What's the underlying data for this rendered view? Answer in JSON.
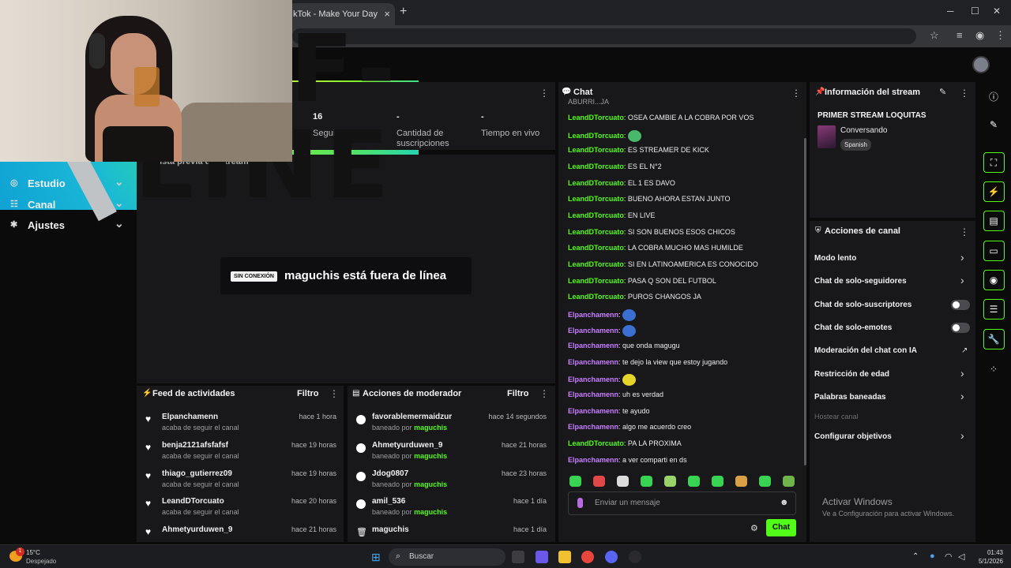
{
  "browser": {
    "tab_title": "kTok - Make Your Day",
    "tab_close": "×",
    "new_tab": "+",
    "win_min": "─",
    "win_max": "☐",
    "win_close": "✕"
  },
  "sidebar": {
    "items": [
      {
        "label": "Estudio",
        "icon": "camera-icon"
      },
      {
        "label": "Canal",
        "icon": "users-icon"
      },
      {
        "label": "Ajustes",
        "icon": "gear-icon"
      }
    ]
  },
  "stats": [
    {
      "value": "16",
      "label": "Seguidores"
    },
    {
      "value": "-",
      "label": "Cantidad de suscripciones"
    },
    {
      "value": "-",
      "label": "Tiempo en vivo"
    }
  ],
  "preview": {
    "title": "Vista previa del stream",
    "badge": "SIN CONEXIÓN",
    "message": "maguchis está fuera de línea",
    "art_line1": "OFF-",
    "art_line2": "LINE"
  },
  "activity_feed": {
    "title": "Feed de actividades",
    "filter": "Filtro",
    "items": [
      {
        "name": "Elpanchamenn",
        "sub": "acaba de seguir el canal",
        "time": "hace 1 hora"
      },
      {
        "name": "benja2121afsfafsf",
        "sub": "acaba de seguir el canal",
        "time": "hace 19 horas"
      },
      {
        "name": "thiago_gutierrez09",
        "sub": "acaba de seguir el canal",
        "time": "hace 19 horas"
      },
      {
        "name": "LeandDTorcuato",
        "sub": "acaba de seguir el canal",
        "time": "hace 20 horas"
      },
      {
        "name": "Ahmetyurduwen_9",
        "sub": "",
        "time": "hace 21 horas"
      }
    ]
  },
  "mod_actions": {
    "title": "Acciones de moderador",
    "filter": "Filtro",
    "by_prefix": "baneado por",
    "by_name": "maguchis",
    "items": [
      {
        "name": "favorablemermaidzur",
        "time": "hace 14 segundos"
      },
      {
        "name": "Ahmetyurduwen_9",
        "time": "hace 21 horas"
      },
      {
        "name": "Jdog0807",
        "time": "hace 23 horas"
      },
      {
        "name": "amil_536",
        "time": "hace 1 día"
      },
      {
        "name": "maguchis",
        "time": "hace 1 día"
      }
    ]
  },
  "chat": {
    "title": "Chat",
    "cut_line": "ABURRI...JA",
    "messages": [
      {
        "user": "LeandDTorcuato",
        "color": "green",
        "text": "OSEA CAMBIE A LA COBRA POR VOS"
      },
      {
        "user": "LeandDTorcuato",
        "color": "green",
        "text": "",
        "emote": "#49b86a"
      },
      {
        "user": "LeandDTorcuato",
        "color": "green",
        "text": "ES STREAMER DE KICK"
      },
      {
        "user": "LeandDTorcuato",
        "color": "green",
        "text": "ES EL N°2"
      },
      {
        "user": "LeandDTorcuato",
        "color": "green",
        "text": "EL 1 ES DAVO"
      },
      {
        "user": "LeandDTorcuato",
        "color": "green",
        "text": "BUENO AHORA ESTAN JUNTO"
      },
      {
        "user": "LeandDTorcuato",
        "color": "green",
        "text": "EN LIVE"
      },
      {
        "user": "LeandDTorcuato",
        "color": "green",
        "text": "SI SON BUENOS ESOS CHICOS"
      },
      {
        "user": "LeandDTorcuato",
        "color": "green",
        "text": "LA COBRA MUCHO MAS HUMILDE"
      },
      {
        "user": "LeandDTorcuato",
        "color": "green",
        "text": "SI EN LATINOAMERICA ES CONOCIDO"
      },
      {
        "user": "LeandDTorcuato",
        "color": "green",
        "text": "PASA Q SON DEL FUTBOL"
      },
      {
        "user": "LeandDTorcuato",
        "color": "green",
        "text": "PUROS CHANGOS JA"
      },
      {
        "user": "Elpanchamenn",
        "color": "purple",
        "text": "",
        "emote": "#3b6fd1"
      },
      {
        "user": "Elpanchamenn",
        "color": "purple",
        "text": "",
        "emote": "#3b6fd1"
      },
      {
        "user": "Elpanchamenn",
        "color": "purple",
        "text": "que onda magugu"
      },
      {
        "user": "Elpanchamenn",
        "color": "purple",
        "text": "te dejo la view que estoy jugando"
      },
      {
        "user": "Elpanchamenn",
        "color": "purple",
        "text": "",
        "emote": "#e5d42a"
      },
      {
        "user": "Elpanchamenn",
        "color": "purple",
        "text": "uh es verdad"
      },
      {
        "user": "Elpanchamenn",
        "color": "purple",
        "text": "te ayudo"
      },
      {
        "user": "Elpanchamenn",
        "color": "purple",
        "text": "algo me acuerdo creo"
      },
      {
        "user": "LeandDTorcuato",
        "color": "green",
        "text": "PA LA PROXIMA"
      },
      {
        "user": "Elpanchamenn",
        "color": "purple",
        "text": "a ver comparti en ds"
      }
    ],
    "input_placeholder": "Enviar un mensaje",
    "send_label": "Chat"
  },
  "stream_info": {
    "title": "Información del stream",
    "stream_title": "PRIMER STREAM LOQUITAS",
    "category": "Conversando",
    "language": "Spanish"
  },
  "channel_actions": {
    "title": "Acciones de canal",
    "items": [
      {
        "label": "Modo lento",
        "control": "chevron"
      },
      {
        "label": "Chat de solo-seguidores",
        "control": "chevron"
      },
      {
        "label": "Chat de solo-suscriptores",
        "control": "toggle",
        "on": false
      },
      {
        "label": "Chat de solo-emotes",
        "control": "toggle",
        "on": false
      },
      {
        "label": "Moderación del chat con IA",
        "control": "external"
      },
      {
        "label": "Restricción de edad",
        "control": "chevron"
      },
      {
        "label": "Palabras baneadas",
        "control": "chevron"
      },
      {
        "label": "Hostear canal",
        "control": "none",
        "disabled": true
      },
      {
        "label": "Configurar objetivos",
        "control": "chevron"
      }
    ]
  },
  "watermark": {
    "line1": "Activar Windows",
    "line2": "Ve a Configuración para activar Windows."
  },
  "taskbar": {
    "weather_temp": "15°C",
    "weather_desc": "Despejado",
    "search_placeholder": "Buscar",
    "time": "01:43",
    "date": "5/1/2026",
    "notif_count": "1"
  },
  "colors": {
    "accent": "#53fc18",
    "chat_purple": "#c77dff",
    "panel": "#18181b",
    "background": "#0b0b0c"
  }
}
